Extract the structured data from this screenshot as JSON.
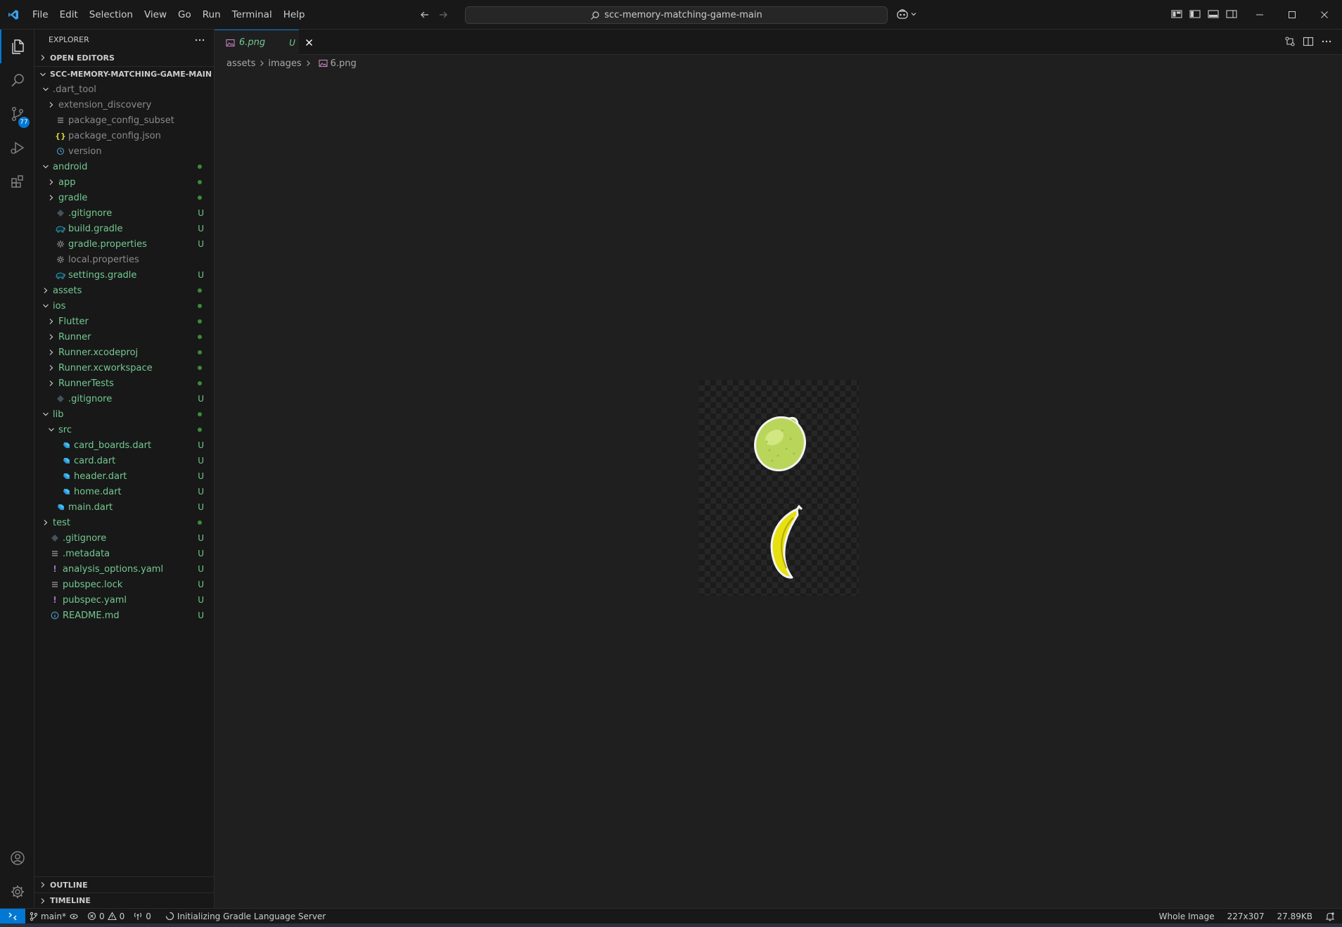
{
  "titlebar": {
    "menu": [
      "File",
      "Edit",
      "Selection",
      "View",
      "Go",
      "Run",
      "Terminal",
      "Help"
    ],
    "search": "scc-memory-matching-game-main"
  },
  "activity": {
    "scm_badge": "77"
  },
  "sidebar": {
    "title": "EXPLORER",
    "open_editors": "OPEN EDITORS",
    "project": "SCC-MEMORY-MATCHING-GAME-MAIN",
    "items": [
      {
        "label": ".dart_tool",
        "depth": 1,
        "kind": "folder-open",
        "color": "grey",
        "status": ""
      },
      {
        "label": "extension_discovery",
        "depth": 2,
        "kind": "folder",
        "color": "grey",
        "status": ""
      },
      {
        "label": "package_config_subset",
        "depth": 2,
        "kind": "lines",
        "color": "grey",
        "status": ""
      },
      {
        "label": "package_config.json",
        "depth": 2,
        "kind": "json",
        "color": "grey",
        "status": ""
      },
      {
        "label": "version",
        "depth": 2,
        "kind": "clock",
        "color": "grey",
        "status": ""
      },
      {
        "label": "android",
        "depth": 1,
        "kind": "folder-open",
        "color": "g",
        "status": "dot"
      },
      {
        "label": "app",
        "depth": 2,
        "kind": "folder",
        "color": "g",
        "status": "dot"
      },
      {
        "label": "gradle",
        "depth": 2,
        "kind": "folder",
        "color": "g",
        "status": "dot"
      },
      {
        "label": ".gitignore",
        "depth": 2,
        "kind": "git",
        "color": "g",
        "status": "U"
      },
      {
        "label": "build.gradle",
        "depth": 2,
        "kind": "gradle",
        "color": "g",
        "status": "U"
      },
      {
        "label": "gradle.properties",
        "depth": 2,
        "kind": "gear",
        "color": "g",
        "status": "U"
      },
      {
        "label": "local.properties",
        "depth": 2,
        "kind": "gear",
        "color": "grey",
        "status": ""
      },
      {
        "label": "settings.gradle",
        "depth": 2,
        "kind": "gradle",
        "color": "g",
        "status": "U"
      },
      {
        "label": "assets",
        "depth": 1,
        "kind": "folder",
        "color": "g",
        "status": "dot"
      },
      {
        "label": "ios",
        "depth": 1,
        "kind": "folder-open",
        "color": "g",
        "status": "dot"
      },
      {
        "label": "Flutter",
        "depth": 2,
        "kind": "folder",
        "color": "g",
        "status": "dot"
      },
      {
        "label": "Runner",
        "depth": 2,
        "kind": "folder",
        "color": "g",
        "status": "dot"
      },
      {
        "label": "Runner.xcodeproj",
        "depth": 2,
        "kind": "folder",
        "color": "g",
        "status": "dot"
      },
      {
        "label": "Runner.xcworkspace",
        "depth": 2,
        "kind": "folder",
        "color": "g",
        "status": "dot"
      },
      {
        "label": "RunnerTests",
        "depth": 2,
        "kind": "folder",
        "color": "g",
        "status": "dot"
      },
      {
        "label": ".gitignore",
        "depth": 2,
        "kind": "git",
        "color": "g",
        "status": "U"
      },
      {
        "label": "lib",
        "depth": 1,
        "kind": "folder-open",
        "color": "g",
        "status": "dot"
      },
      {
        "label": "src",
        "depth": 2,
        "kind": "folder-open",
        "color": "g",
        "status": "dot"
      },
      {
        "label": "card_boards.dart",
        "depth": 3,
        "kind": "dart",
        "color": "g",
        "status": "U"
      },
      {
        "label": "card.dart",
        "depth": 3,
        "kind": "dart",
        "color": "g",
        "status": "U"
      },
      {
        "label": "header.dart",
        "depth": 3,
        "kind": "dart",
        "color": "g",
        "status": "U"
      },
      {
        "label": "home.dart",
        "depth": 3,
        "kind": "dart",
        "color": "g",
        "status": "U"
      },
      {
        "label": "main.dart",
        "depth": 2,
        "kind": "dart",
        "color": "g",
        "status": "U"
      },
      {
        "label": "test",
        "depth": 1,
        "kind": "folder",
        "color": "g",
        "status": "dot"
      },
      {
        "label": ".gitignore",
        "depth": 1,
        "kind": "git",
        "color": "g",
        "status": "U"
      },
      {
        "label": ".metadata",
        "depth": 1,
        "kind": "lines",
        "color": "g",
        "status": "U"
      },
      {
        "label": "analysis_options.yaml",
        "depth": 1,
        "kind": "yaml",
        "color": "g",
        "status": "U"
      },
      {
        "label": "pubspec.lock",
        "depth": 1,
        "kind": "lines",
        "color": "g",
        "status": "U"
      },
      {
        "label": "pubspec.yaml",
        "depth": 1,
        "kind": "yaml",
        "color": "g",
        "status": "U"
      },
      {
        "label": "README.md",
        "depth": 1,
        "kind": "info",
        "color": "g",
        "status": "U"
      }
    ],
    "outline": "OUTLINE",
    "timeline": "TIMELINE"
  },
  "editor": {
    "tab_label": "6.png",
    "tab_status": "U",
    "breadcrumb": [
      "assets",
      "images",
      "6.png"
    ]
  },
  "statusbar": {
    "branch": "main*",
    "errors": "0",
    "warnings": "0",
    "ports": "0",
    "task": "Initializing Gradle Language Server",
    "zoom": "Whole Image",
    "dimensions": "227x307",
    "filesize": "27.89KB"
  },
  "colors": {
    "accent": "#0078d4",
    "untracked": "#73c991",
    "background": "#1f1f1f"
  }
}
